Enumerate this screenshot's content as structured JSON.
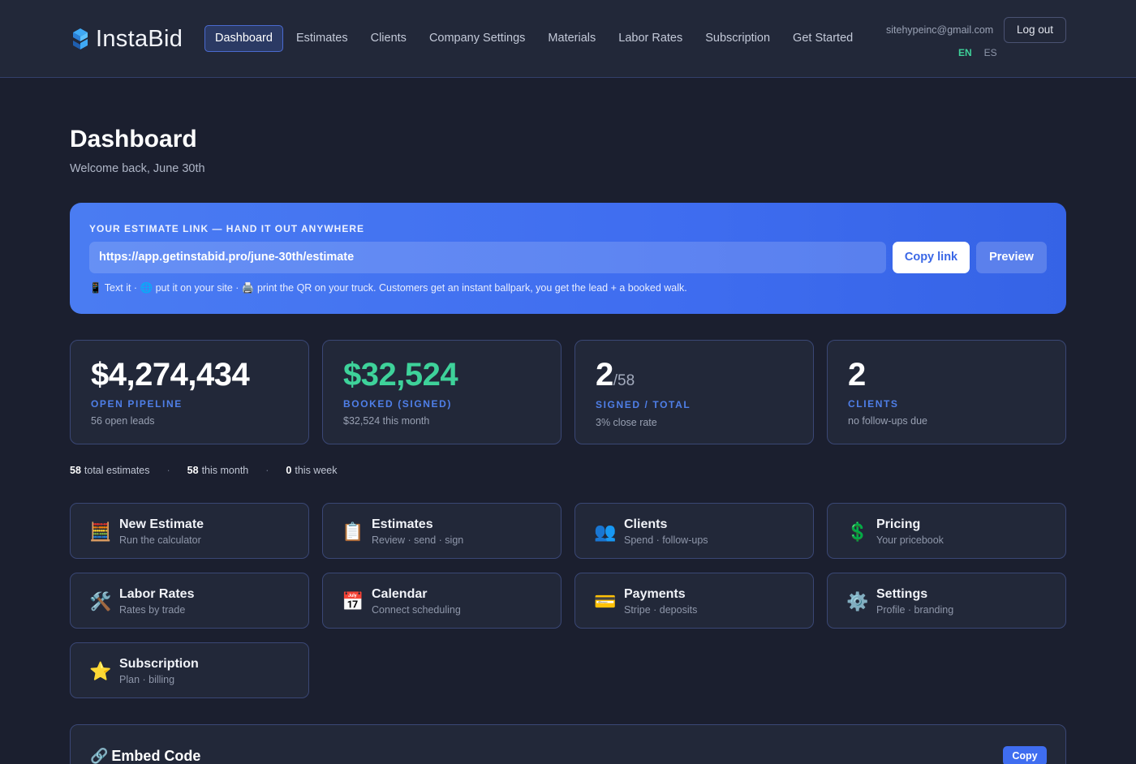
{
  "header": {
    "brand": "InstaBid",
    "nav": [
      {
        "label": "Dashboard",
        "active": true
      },
      {
        "label": "Estimates"
      },
      {
        "label": "Clients"
      },
      {
        "label": "Company Settings"
      },
      {
        "label": "Materials"
      },
      {
        "label": "Labor Rates"
      },
      {
        "label": "Subscription"
      },
      {
        "label": "Get Started"
      }
    ],
    "user_email": "sitehypeinc@gmail.com",
    "lang_en": "EN",
    "lang_es": "ES",
    "logout_label": "Log out"
  },
  "page": {
    "title": "Dashboard",
    "welcome": "Welcome back, June 30th"
  },
  "estimate_link": {
    "label": "YOUR ESTIMATE LINK — HAND IT OUT ANYWHERE",
    "url": "https://app.getinstabid.pro/june-30th/estimate",
    "copy_label": "Copy link",
    "preview_label": "Preview",
    "help": "📱 Text it · 🌐 put it on your site · 🖨️ print the QR on your truck. Customers get an instant ballpark, you get the lead + a booked walk."
  },
  "stats": [
    {
      "value": "$4,274,434",
      "label": "OPEN PIPELINE",
      "sub": "56 open leads"
    },
    {
      "value": "$32,524",
      "label": "BOOKED (SIGNED)",
      "sub": "$32,524 this month"
    },
    {
      "value": "2",
      "of": "/58",
      "label": "SIGNED / TOTAL",
      "sub": "3% close rate"
    },
    {
      "value": "2",
      "label": "CLIENTS",
      "sub": "no follow-ups due"
    }
  ],
  "summary": {
    "total_num": "58",
    "total_text": "total estimates",
    "month_num": "58",
    "month_text": "this month",
    "week_num": "0",
    "week_text": "this week",
    "sep": "·"
  },
  "tiles": [
    {
      "icon": "🧮",
      "title": "New Estimate",
      "sub": "Run the calculator"
    },
    {
      "icon": "📋",
      "title": "Estimates",
      "sub": "Review · send · sign"
    },
    {
      "icon": "👥",
      "title": "Clients",
      "sub": "Spend · follow-ups"
    },
    {
      "icon": "💲",
      "title": "Pricing",
      "sub": "Your pricebook"
    },
    {
      "icon": "🛠️",
      "title": "Labor Rates",
      "sub": "Rates by trade"
    },
    {
      "icon": "📅",
      "title": "Calendar",
      "sub": "Connect scheduling"
    },
    {
      "icon": "💳",
      "title": "Payments",
      "sub": "Stripe · deposits"
    },
    {
      "icon": "⚙️",
      "title": "Settings",
      "sub": "Profile · branding"
    },
    {
      "icon": "⭐",
      "title": "Subscription",
      "sub": "Plan · billing"
    }
  ],
  "embed": {
    "icon": "🔗",
    "title": "Embed Code",
    "copy_label": "Copy"
  },
  "colors": {
    "accent": "#3f6df0",
    "success": "#3ed29a",
    "background": "#1b1f2f",
    "card": "#222839"
  }
}
